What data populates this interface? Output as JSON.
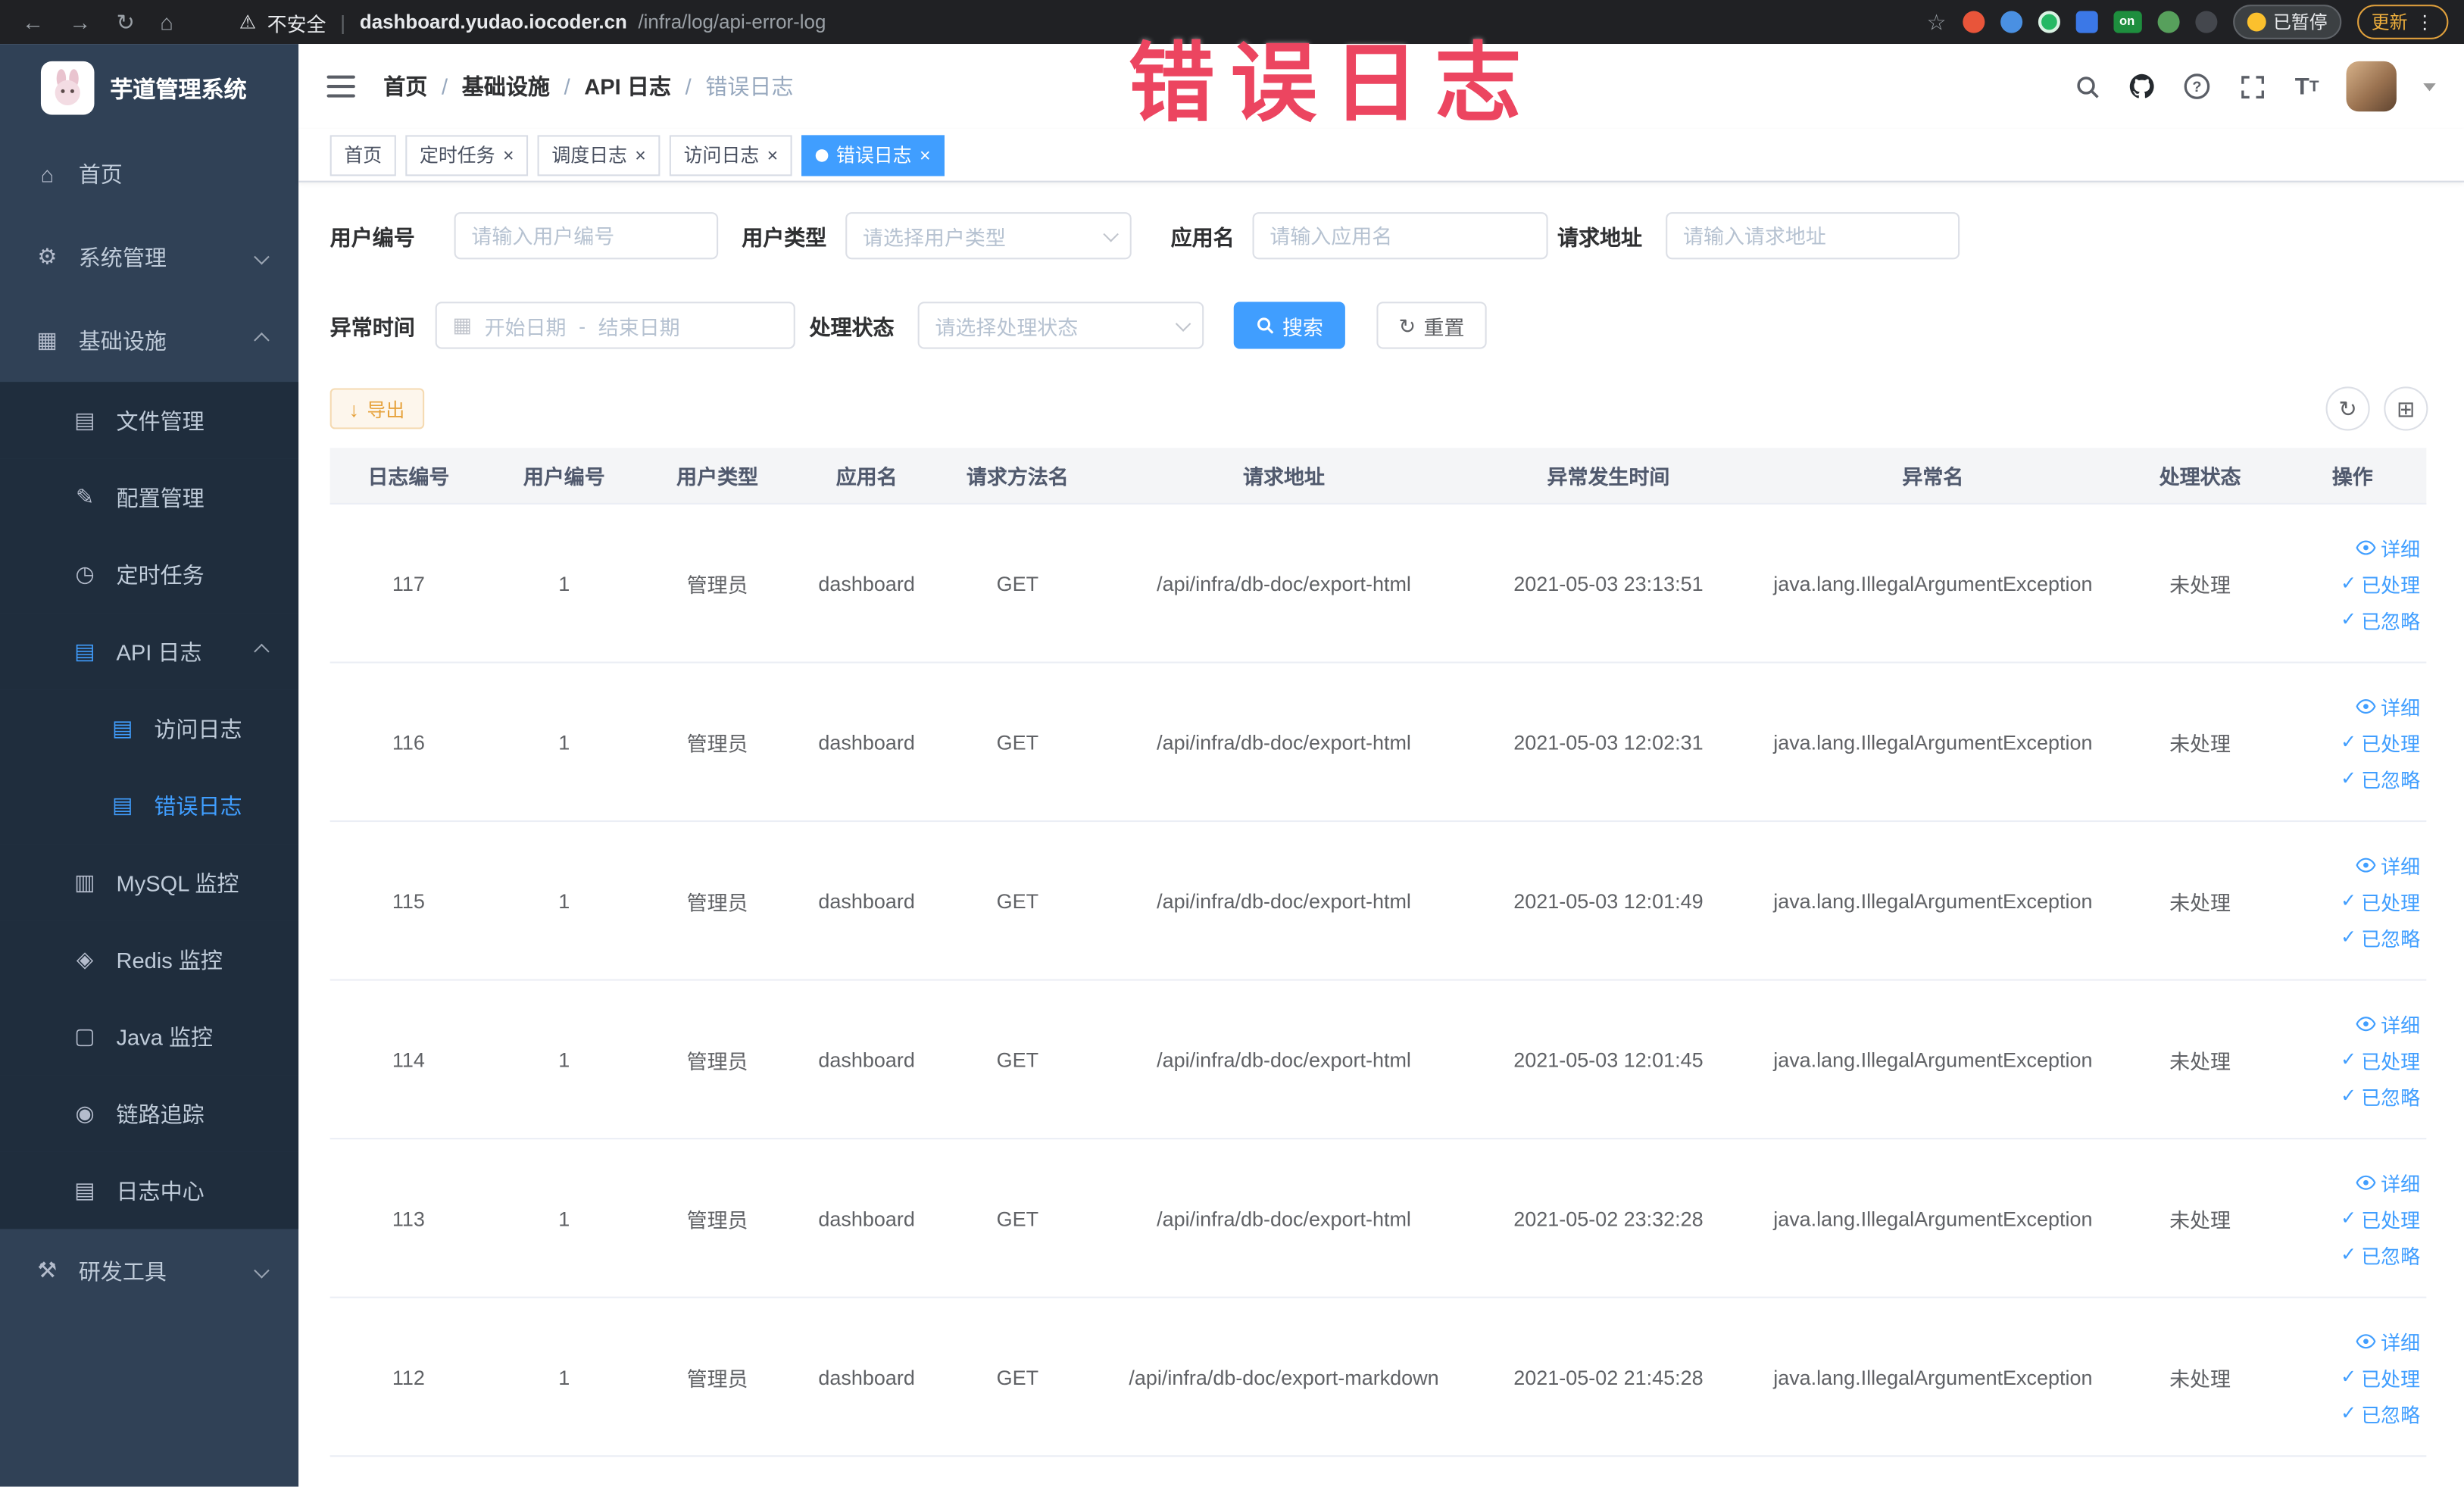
{
  "annotation": {
    "overlay_text": "错误日志"
  },
  "browser": {
    "security_label": "不安全",
    "url_host": "dashboard.yudao.iocoder.cn",
    "url_path": "/infra/log/api-error-log",
    "on_badge": "on",
    "paused_badge": "已暂停",
    "update_label": "更新"
  },
  "sidebar": {
    "logo_title": "芋道管理系统",
    "items": [
      {
        "label": "首页",
        "icon": "⌂"
      },
      {
        "label": "系统管理",
        "icon": "⚙"
      },
      {
        "label": "基础设施",
        "icon": "▦"
      },
      {
        "label": "文件管理",
        "icon": "▤"
      },
      {
        "label": "配置管理",
        "icon": "✎"
      },
      {
        "label": "定时任务",
        "icon": "◷"
      },
      {
        "label": "API 日志",
        "icon": "▤"
      },
      {
        "label": "访问日志",
        "icon": "▤"
      },
      {
        "label": "错误日志",
        "icon": "▤"
      },
      {
        "label": "MySQL 监控",
        "icon": "▥"
      },
      {
        "label": "Redis 监控",
        "icon": "◈"
      },
      {
        "label": "Java 监控",
        "icon": "▢"
      },
      {
        "label": "链路追踪",
        "icon": "◉"
      },
      {
        "label": "日志中心",
        "icon": "▤"
      },
      {
        "label": "研发工具",
        "icon": "⚒"
      }
    ]
  },
  "header": {
    "breadcrumbs": [
      "首页",
      "基础设施",
      "API 日志",
      "错误日志"
    ]
  },
  "tabs": [
    {
      "label": "首页"
    },
    {
      "label": "定时任务"
    },
    {
      "label": "调度日志"
    },
    {
      "label": "访问日志"
    },
    {
      "label": "错误日志"
    }
  ],
  "filters": {
    "user_id": {
      "label": "用户编号",
      "placeholder": "请输入用户编号"
    },
    "user_type": {
      "label": "用户类型",
      "placeholder": "请选择用户类型"
    },
    "app_name": {
      "label": "应用名",
      "placeholder": "请输入应用名"
    },
    "request_url": {
      "label": "请求地址",
      "placeholder": "请输入请求地址"
    },
    "exception_time": {
      "label": "异常时间",
      "start_placeholder": "开始日期",
      "separator": "-",
      "end_placeholder": "结束日期"
    },
    "process_status": {
      "label": "处理状态",
      "placeholder": "请选择处理状态"
    },
    "search_button": "搜索",
    "reset_button": "重置"
  },
  "toolbar": {
    "export_button": "导出"
  },
  "table": {
    "columns": [
      "日志编号",
      "用户编号",
      "用户类型",
      "应用名",
      "请求方法名",
      "请求地址",
      "异常发生时间",
      "异常名",
      "处理状态",
      "操作"
    ],
    "actions": [
      "详细",
      "已处理",
      "已忽略"
    ],
    "rows": [
      {
        "log_id": "117",
        "user_id": "1",
        "user_type": "管理员",
        "app_name": "dashboard",
        "method": "GET",
        "url": "/api/infra/db-doc/export-html",
        "time": "2021-05-03 23:13:51",
        "exception": "java.lang.IllegalArgumentException",
        "status": "未处理"
      },
      {
        "log_id": "116",
        "user_id": "1",
        "user_type": "管理员",
        "app_name": "dashboard",
        "method": "GET",
        "url": "/api/infra/db-doc/export-html",
        "time": "2021-05-03 12:02:31",
        "exception": "java.lang.IllegalArgumentException",
        "status": "未处理"
      },
      {
        "log_id": "115",
        "user_id": "1",
        "user_type": "管理员",
        "app_name": "dashboard",
        "method": "GET",
        "url": "/api/infra/db-doc/export-html",
        "time": "2021-05-03 12:01:49",
        "exception": "java.lang.IllegalArgumentException",
        "status": "未处理"
      },
      {
        "log_id": "114",
        "user_id": "1",
        "user_type": "管理员",
        "app_name": "dashboard",
        "method": "GET",
        "url": "/api/infra/db-doc/export-html",
        "time": "2021-05-03 12:01:45",
        "exception": "java.lang.IllegalArgumentException",
        "status": "未处理"
      },
      {
        "log_id": "113",
        "user_id": "1",
        "user_type": "管理员",
        "app_name": "dashboard",
        "method": "GET",
        "url": "/api/infra/db-doc/export-html",
        "time": "2021-05-02 23:32:28",
        "exception": "java.lang.IllegalArgumentException",
        "status": "未处理"
      },
      {
        "log_id": "112",
        "user_id": "1",
        "user_type": "管理员",
        "app_name": "dashboard",
        "method": "GET",
        "url": "/api/infra/db-doc/export-markdown",
        "time": "2021-05-02 21:45:28",
        "exception": "java.lang.IllegalArgumentException",
        "status": "未处理"
      }
    ]
  },
  "colors": {
    "accent": "#409eff",
    "sidebar_bg": "#304156",
    "submenu_bg": "#1f2d3d",
    "sidebar_text": "#bfcbd9",
    "warning_button_text": "#e6a23c",
    "annotation_red": "#ec4560",
    "chrome_bg": "#202124"
  }
}
